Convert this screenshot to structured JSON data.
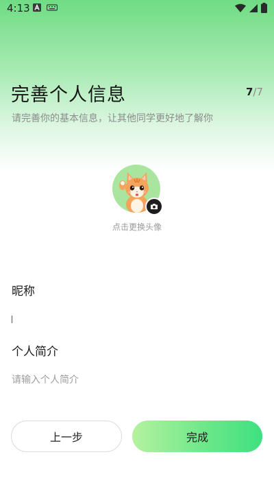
{
  "status_bar": {
    "time": "4:13"
  },
  "header": {
    "title": "完善个人信息",
    "step_current": "7",
    "step_total": "/7",
    "subtitle": "请完善你的基本信息，让其他同学更好地了解你"
  },
  "avatar": {
    "caption": "点击更换头像",
    "icon": "camera-icon"
  },
  "form": {
    "nickname_label": "昵称",
    "nickname_value": "",
    "intro_label": "个人简介",
    "intro_placeholder": "请输入个人简介",
    "intro_value": ""
  },
  "actions": {
    "prev_label": "上一步",
    "done_label": "完成"
  },
  "colors": {
    "accent_start": "#b4f29f",
    "accent_end": "#3fe07f",
    "header_green": "#6fdc84"
  }
}
